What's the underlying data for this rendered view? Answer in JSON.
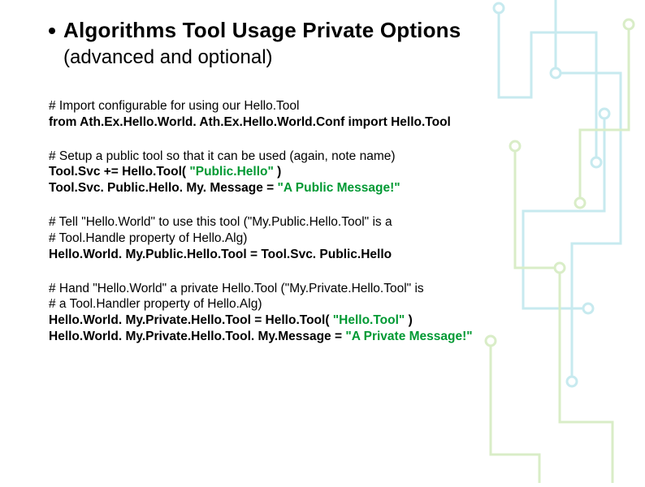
{
  "title": "Algorithms Tool Usage Private Options",
  "subtitle": "(advanced and optional)",
  "blocks": {
    "b0": {
      "l0": "# Import configurable for using our Hello.Tool",
      "l1a": "from Ath.Ex.Hello.World. Ath.Ex.Hello.World.Conf import Hello.Tool"
    },
    "b1": {
      "l0": "# Setup a public tool so that it can be used (again, note name)",
      "l1a": "Tool.Svc += Hello.Tool( ",
      "l1b": "\"Public.Hello\"",
      "l1c": " )",
      "l2a": "Tool.Svc. Public.Hello. My. Message = ",
      "l2b": "\"A Public Message!\""
    },
    "b2": {
      "l0": "# Tell \"Hello.World\" to use this tool (\"My.Public.Hello.Tool\" is a",
      "l1": "# Tool.Handle property of Hello.Alg)",
      "l2a": "Hello.World. My.Public.Hello.Tool = Tool.Svc. Public.Hello"
    },
    "b3": {
      "l0": "# Hand \"Hello.World\" a private Hello.Tool (\"My.Private.Hello.Tool\" is",
      "l1": "# a Tool.Handler property of Hello.Alg)",
      "l2a": "Hello.World. My.Private.Hello.Tool = Hello.Tool( ",
      "l2b": "\"Hello.Tool\"",
      "l2c": " )",
      "l3a": "Hello.World. My.Private.Hello.Tool. My.Message = ",
      "l3b": "\"A Private Message!\""
    }
  }
}
